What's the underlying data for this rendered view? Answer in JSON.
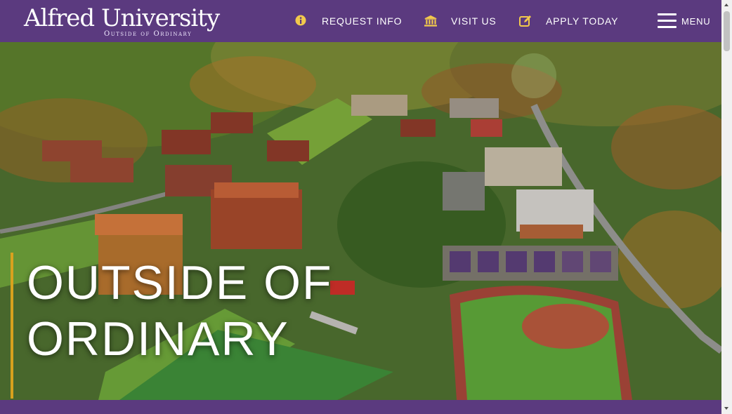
{
  "header": {
    "logo_text": "Alfred University",
    "logo_tagline": "Outside of Ordinary",
    "nav": [
      {
        "label": "REQUEST INFO",
        "icon": "info-circle-icon"
      },
      {
        "label": "VISIT US",
        "icon": "university-building-icon"
      },
      {
        "label": "APPLY TODAY",
        "icon": "edit-pencil-icon"
      }
    ],
    "menu_label": "MENU"
  },
  "hero": {
    "headline_line1": "OUTSIDE OF",
    "headline_line2": "ORDINARY",
    "image_description_icon": "campus-aerial-photo"
  },
  "colors": {
    "brand_purple": "#5b3a7f",
    "accent_gold": "#d8a11e"
  }
}
